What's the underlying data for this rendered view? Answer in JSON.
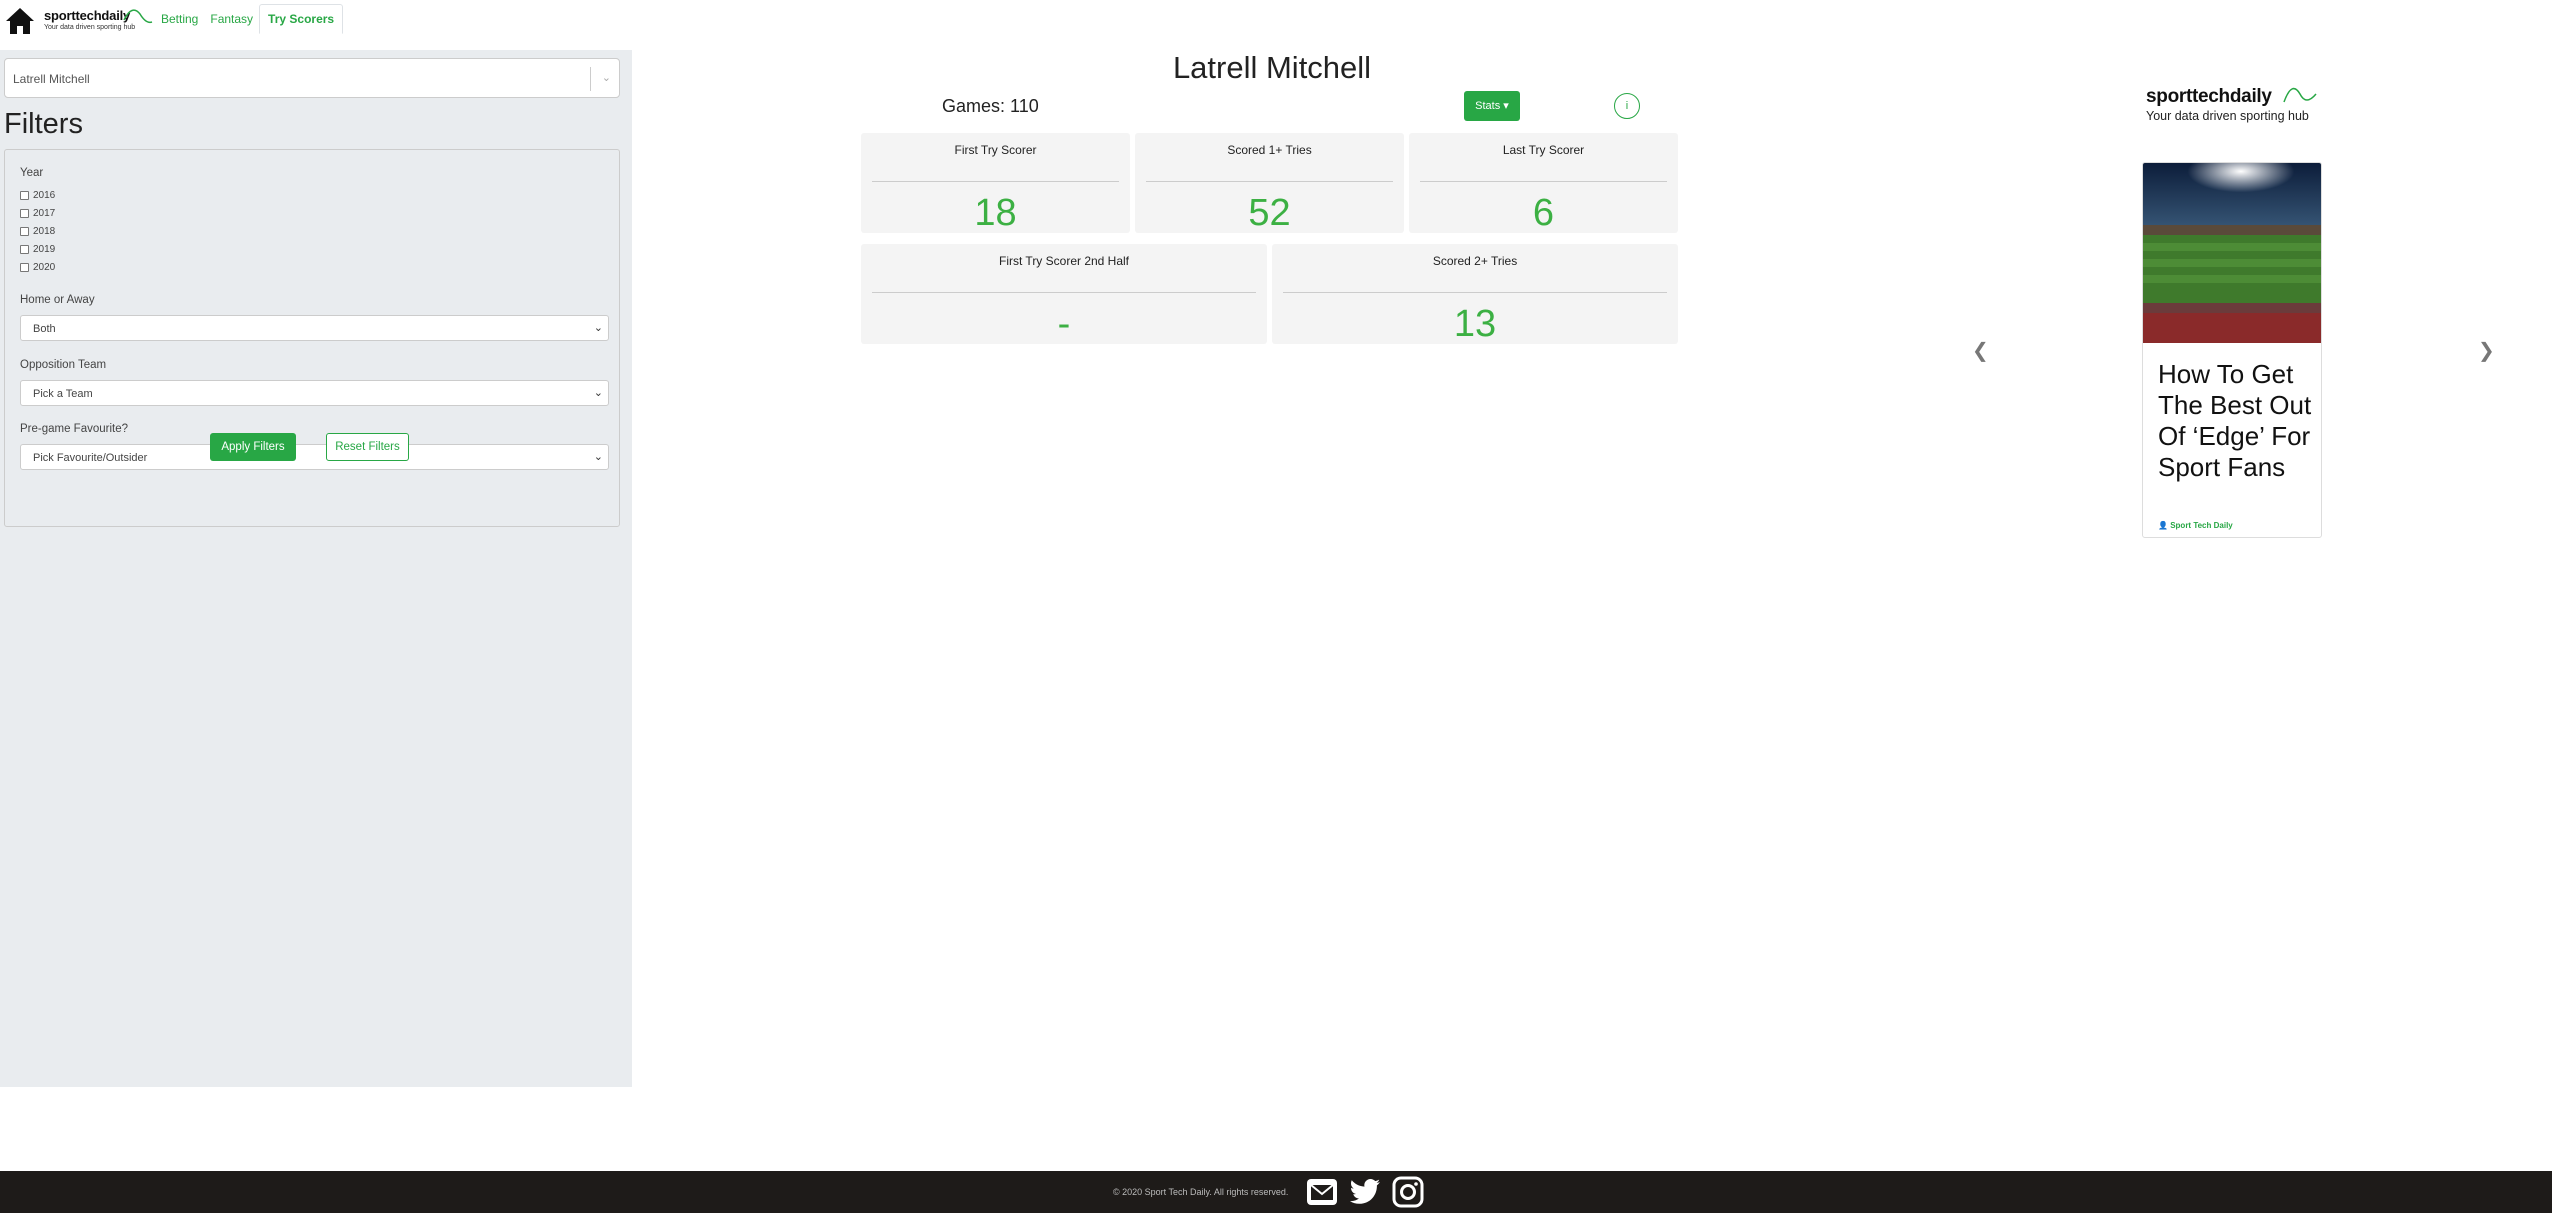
{
  "nav": {
    "brand_name": "sporttechdaily",
    "brand_tagline": "Your data driven sporting hub",
    "links": [
      "Betting",
      "Fantasy",
      "Try Scorers"
    ],
    "active": "Try Scorers"
  },
  "sidebar": {
    "player_value": "Latrell Mitchell",
    "filters_title": "Filters",
    "year_label": "Year",
    "years": [
      "2016",
      "2017",
      "2018",
      "2019",
      "2020"
    ],
    "home_away_label": "Home or Away",
    "home_away_value": "Both",
    "opposition_label": "Opposition Team",
    "opposition_value": "Pick a Team",
    "favourite_label": "Pre-game Favourite?",
    "favourite_value": "Pick Favourite/Outsider",
    "apply_label": "Apply Filters",
    "reset_label": "Reset Filters"
  },
  "main": {
    "player_name": "Latrell Mitchell",
    "games_text": "Games: 110",
    "stats_label": "Stats",
    "info_label": "i",
    "cards_row1": [
      {
        "title": "First Try Scorer",
        "value": "18"
      },
      {
        "title": "Scored 1+ Tries",
        "value": "52"
      },
      {
        "title": "Last Try Scorer",
        "value": "6"
      }
    ],
    "cards_row2": [
      {
        "title": "First Try Scorer 2nd Half",
        "value": "-"
      },
      {
        "title": "Scored 2+ Tries",
        "value": "13"
      }
    ]
  },
  "ad": {
    "brand_name": "sporttechdaily",
    "brand_tagline": "Your data driven sporting hub",
    "headline": "How To Get The Best Out Of ‘Edge’ For Sport Fans",
    "author": "Sport Tech Daily"
  },
  "footer": {
    "copyright": "© 2020 Sport Tech Daily. All rights reserved.",
    "icons": [
      "mail-icon",
      "twitter-icon",
      "instagram-icon"
    ]
  },
  "colors": {
    "accent": "#28a745",
    "stat_value": "#3cb043",
    "sidebar_bg": "#e9ecef",
    "footer_bg": "#1e1b19"
  }
}
